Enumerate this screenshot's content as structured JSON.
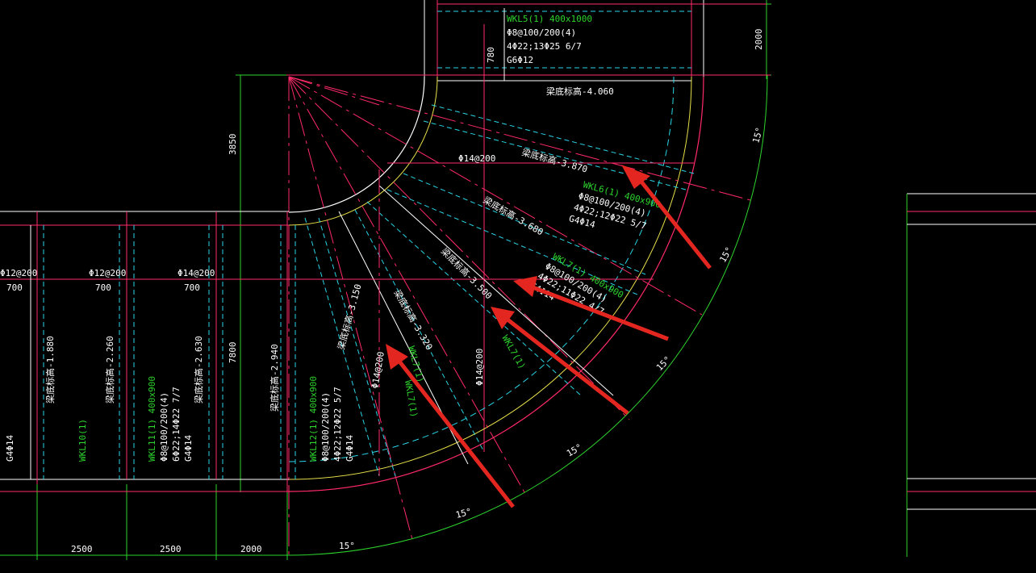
{
  "colors": {
    "background": "#000000",
    "axis_line": "#ff2a6a",
    "beam_edge": "#ffffff",
    "beam_dashed": "#29d6e6",
    "wall_yellow": "#e8e04a",
    "dimension_green": "#2dd42d",
    "beam_label_green": "#2dd42d",
    "annotation_text": "#ffffff",
    "arrow_red": "#e3261f"
  },
  "top_beam": {
    "name": "WKL5(1) 400x1000",
    "stirrup": "Φ8@100/200(4)",
    "bars": "4Φ22;13Φ25 6/7",
    "side_bars": "G6Φ12",
    "height_dim": "780",
    "elevation": "梁底标高-4.060"
  },
  "dims": {
    "left_vertical": "3850",
    "right_vertical": "2000",
    "mid_vertical": "7800",
    "bottom_1": "2500",
    "bottom_2": "2500",
    "bottom_3": "2000"
  },
  "angle_labels": [
    "15°",
    "15°",
    "15°",
    "15°",
    "15°",
    "15°"
  ],
  "radial_beams": [
    {
      "elevation": "梁底标高-3.870",
      "bar": "Φ14@200"
    },
    {
      "elevation": "梁底标高-3.680"
    },
    {
      "elevation": "梁底标高-3.500"
    },
    {
      "elevation": "梁底标高-3.320"
    },
    {
      "elevation": "梁底标高-3.150",
      "bar": "Φ14@200"
    }
  ],
  "wkl6": {
    "name": "WKL6(1) 400x900",
    "stirrup": "Φ8@100/200(4)",
    "bars": "4Φ22;12Φ22 5/7",
    "side_bars": "G4Φ14"
  },
  "wkl7": {
    "name": "WKL7(1) 400x900",
    "stirrup": "Φ8@100/200(4)",
    "bars": "4Φ22;11Φ22 4/7",
    "side_bars": "G4Φ14"
  },
  "wkl7_short": "WKL7(1)",
  "bar_mid": "Φ14@200",
  "wkl7_left": "WKL7(1)",
  "wkl7_left2": "WKL7(1)",
  "bottom_strip": {
    "bar_labels": [
      "Φ12@200",
      "Φ12@200",
      "Φ14@200"
    ],
    "spacings": [
      "700",
      "700",
      "700"
    ],
    "elevations": [
      "梁底标高-1.880",
      "梁底标高-2.260",
      "梁底标高-2.630",
      "梁底标高-2.940"
    ],
    "wkl10": "WKL10(1)",
    "wkl11": {
      "name": "WKL11(1) 400x900",
      "stirrup": "Φ8@100/200(4)",
      "bars": "6Φ22;14Φ22 7/7",
      "side_bars": "G4Φ14"
    },
    "wkl12": {
      "name": "WKL12(1) 400x900",
      "stirrup": "Φ8@100/200(4)",
      "bars": "4Φ22;12Φ22 5/7",
      "side_bars": "G4Φ14"
    },
    "left_cut": "G4Φ14"
  }
}
